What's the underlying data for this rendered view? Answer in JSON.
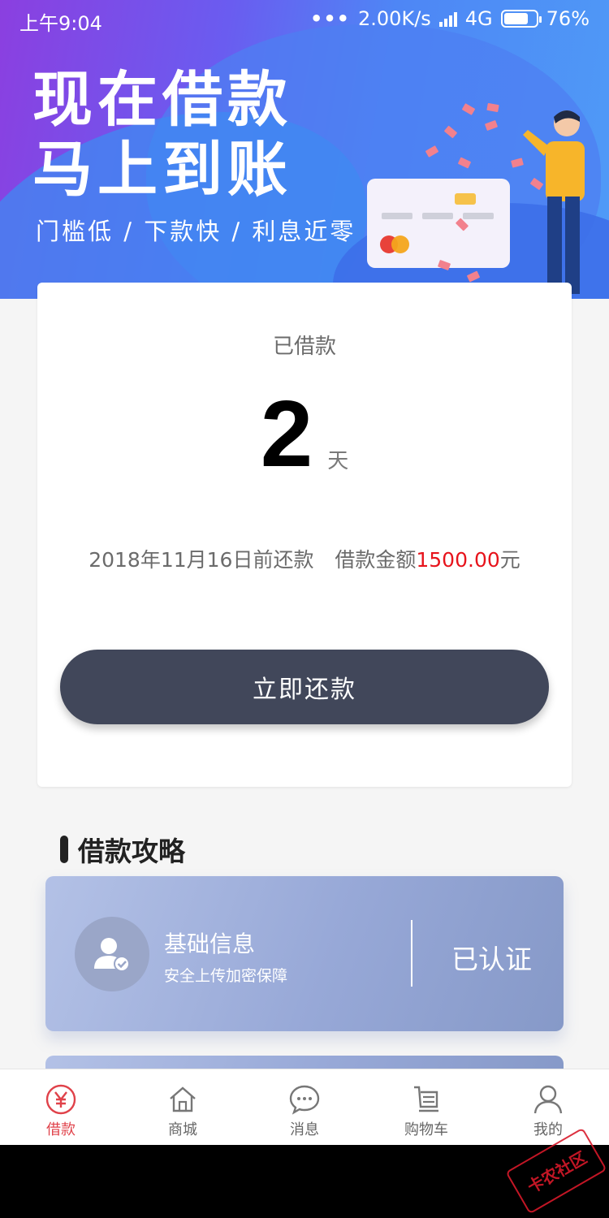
{
  "status_bar": {
    "time": "上午9:04",
    "dots": "•••",
    "speed": "2.00K/s",
    "network": "4G",
    "battery": "76%",
    "battery_level": 0.76
  },
  "banner": {
    "headline_1": "现在借款",
    "headline_2": "马上到账",
    "tagline": "门槛低 / 下款快 / 利息近零"
  },
  "loan": {
    "label": "已借款",
    "days": "2",
    "days_unit": "天",
    "repay_date_text": "2018年11月16日前还款",
    "amount_prefix": "借款金额",
    "amount": "1500.00",
    "amount_unit": "元",
    "repay_button": "立即还款"
  },
  "guide": {
    "title": "借款攻略",
    "items": [
      {
        "title": "基础信息",
        "desc": "安全上传加密保障",
        "status": "已认证"
      }
    ]
  },
  "tabs": [
    {
      "label": "借款",
      "icon": "yen-circle-icon",
      "active": true
    },
    {
      "label": "商城",
      "icon": "home-icon",
      "active": false
    },
    {
      "label": "消息",
      "icon": "chat-bubble-icon",
      "active": false
    },
    {
      "label": "购物车",
      "icon": "cart-icon",
      "active": false
    },
    {
      "label": "我的",
      "icon": "user-icon",
      "active": false
    }
  ],
  "watermark": "卡农社区",
  "colors": {
    "accent_red": "#e7141c",
    "tab_active": "#e0424a",
    "button_dark": "#41475a",
    "banner_blue": "#4e86f5"
  }
}
